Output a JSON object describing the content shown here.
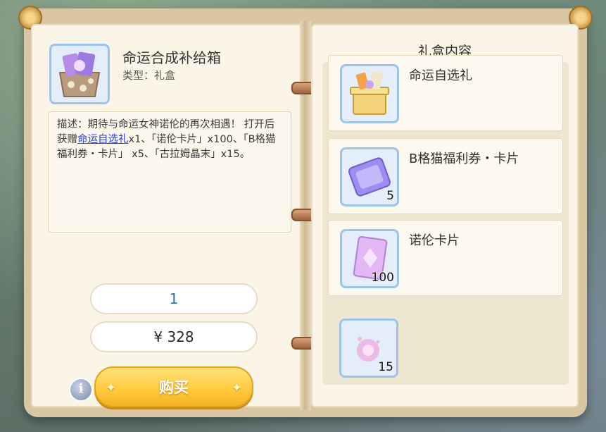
{
  "item": {
    "name": "命运合成补给箱",
    "type": "类型：礼盒",
    "icon": "gift-box-icon",
    "description_prefix": "描述：期待与命运女神诺伦的再次相遇！ 打开后获赠",
    "description_link": "命运自选礼",
    "description_suffix": "x1、「诺伦卡片」x100、「B格猫福利券・卡片」 x5、「古拉姆晶末」x15。"
  },
  "purchase": {
    "quantity": "1",
    "price": "¥ 328",
    "buy_label": "购买",
    "info_icon": "info-icon",
    "info_glyph": "i"
  },
  "contents": {
    "title": "礼盒内容",
    "items": [
      {
        "name": "命运自选礼",
        "count": "",
        "icon": "golden-gift-box-icon"
      },
      {
        "name": "B格猫福利券・卡片",
        "count": "5",
        "icon": "purple-ticket-icon"
      },
      {
        "name": "诺伦卡片",
        "count": "100",
        "icon": "pink-card-icon"
      },
      {
        "name": "",
        "count": "15",
        "icon": "pink-crystal-dust-icon"
      }
    ]
  },
  "colors": {
    "link": "#2a43d8",
    "quantity": "#2f6fb0",
    "buy_button": "#ffc93a",
    "slot_border": "#9ec3ea"
  }
}
